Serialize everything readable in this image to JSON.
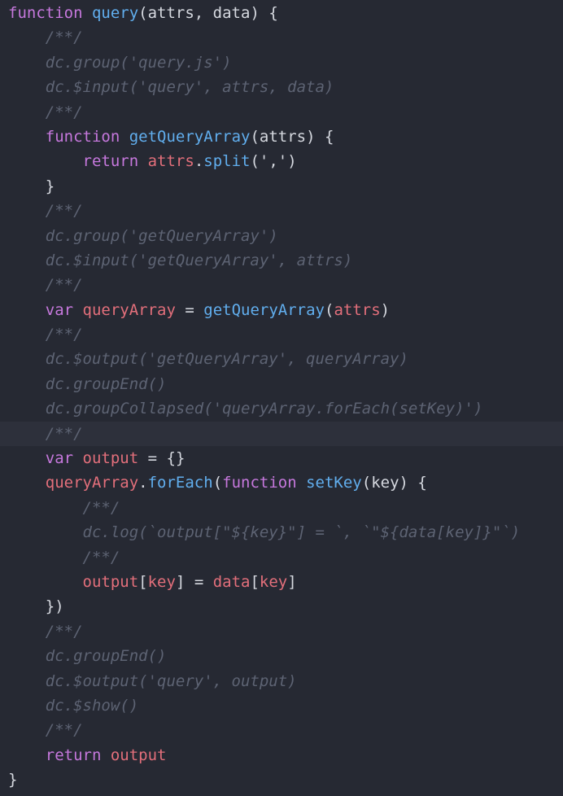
{
  "editor": {
    "colors": {
      "background": "#262933",
      "highlight_line": "#2d303b",
      "keyword": "#c678dd",
      "function": "#61aeee",
      "text": "#d6d9e0",
      "variable": "#e36f7b",
      "comment": "#5d6373"
    },
    "highlighted_line_index": 17,
    "lines": [
      [
        {
          "t": "kw",
          "v": "function"
        },
        {
          "t": "txt",
          "v": " "
        },
        {
          "t": "fn",
          "v": "query"
        },
        {
          "t": "txt",
          "v": "(attrs, data) {"
        }
      ],
      [
        {
          "t": "txt",
          "v": "    "
        },
        {
          "t": "cm",
          "v": "/**/"
        }
      ],
      [
        {
          "t": "txt",
          "v": "    "
        },
        {
          "t": "cm",
          "v": "dc.group('query.js')"
        }
      ],
      [
        {
          "t": "txt",
          "v": "    "
        },
        {
          "t": "cm",
          "v": "dc.$input('query', attrs, data)"
        }
      ],
      [
        {
          "t": "txt",
          "v": "    "
        },
        {
          "t": "cm",
          "v": "/**/"
        }
      ],
      [
        {
          "t": "txt",
          "v": "    "
        },
        {
          "t": "kw",
          "v": "function"
        },
        {
          "t": "txt",
          "v": " "
        },
        {
          "t": "fn",
          "v": "getQueryArray"
        },
        {
          "t": "txt",
          "v": "(attrs) {"
        }
      ],
      [
        {
          "t": "txt",
          "v": "        "
        },
        {
          "t": "kw",
          "v": "return"
        },
        {
          "t": "txt",
          "v": " "
        },
        {
          "t": "var",
          "v": "attrs"
        },
        {
          "t": "txt",
          "v": "."
        },
        {
          "t": "fn",
          "v": "split"
        },
        {
          "t": "txt",
          "v": "(',')"
        }
      ],
      [
        {
          "t": "txt",
          "v": "    }"
        }
      ],
      [
        {
          "t": "txt",
          "v": "    "
        },
        {
          "t": "cm",
          "v": "/**/"
        }
      ],
      [
        {
          "t": "txt",
          "v": "    "
        },
        {
          "t": "cm",
          "v": "dc.group('getQueryArray')"
        }
      ],
      [
        {
          "t": "txt",
          "v": "    "
        },
        {
          "t": "cm",
          "v": "dc.$input('getQueryArray', attrs)"
        }
      ],
      [
        {
          "t": "txt",
          "v": "    "
        },
        {
          "t": "cm",
          "v": "/**/"
        }
      ],
      [
        {
          "t": "txt",
          "v": "    "
        },
        {
          "t": "kw",
          "v": "var"
        },
        {
          "t": "txt",
          "v": " "
        },
        {
          "t": "var",
          "v": "queryArray"
        },
        {
          "t": "txt",
          "v": " = "
        },
        {
          "t": "fn",
          "v": "getQueryArray"
        },
        {
          "t": "txt",
          "v": "("
        },
        {
          "t": "var",
          "v": "attrs"
        },
        {
          "t": "txt",
          "v": ")"
        }
      ],
      [
        {
          "t": "txt",
          "v": "    "
        },
        {
          "t": "cm",
          "v": "/**/"
        }
      ],
      [
        {
          "t": "txt",
          "v": "    "
        },
        {
          "t": "cm",
          "v": "dc.$output('getQueryArray', queryArray)"
        }
      ],
      [
        {
          "t": "txt",
          "v": "    "
        },
        {
          "t": "cm",
          "v": "dc.groupEnd()"
        }
      ],
      [
        {
          "t": "txt",
          "v": "    "
        },
        {
          "t": "cm",
          "v": "dc.groupCollapsed('queryArray.forEach(setKey)')"
        }
      ],
      [
        {
          "t": "txt",
          "v": "    "
        },
        {
          "t": "cm",
          "v": "/**/"
        }
      ],
      [
        {
          "t": "txt",
          "v": "    "
        },
        {
          "t": "kw",
          "v": "var"
        },
        {
          "t": "txt",
          "v": " "
        },
        {
          "t": "var",
          "v": "output"
        },
        {
          "t": "txt",
          "v": " = {}"
        }
      ],
      [
        {
          "t": "txt",
          "v": "    "
        },
        {
          "t": "var",
          "v": "queryArray"
        },
        {
          "t": "txt",
          "v": "."
        },
        {
          "t": "fn",
          "v": "forEach"
        },
        {
          "t": "txt",
          "v": "("
        },
        {
          "t": "kw",
          "v": "function"
        },
        {
          "t": "txt",
          "v": " "
        },
        {
          "t": "fn",
          "v": "setKey"
        },
        {
          "t": "txt",
          "v": "(key) {"
        }
      ],
      [
        {
          "t": "txt",
          "v": "        "
        },
        {
          "t": "cm",
          "v": "/**/"
        }
      ],
      [
        {
          "t": "txt",
          "v": "        "
        },
        {
          "t": "cm",
          "v": "dc.log(`output[\"${key}\"] = `, `\"${data[key]}\"`)"
        }
      ],
      [
        {
          "t": "txt",
          "v": "        "
        },
        {
          "t": "cm",
          "v": "/**/"
        }
      ],
      [
        {
          "t": "txt",
          "v": "        "
        },
        {
          "t": "var",
          "v": "output"
        },
        {
          "t": "txt",
          "v": "["
        },
        {
          "t": "var",
          "v": "key"
        },
        {
          "t": "txt",
          "v": "] = "
        },
        {
          "t": "var",
          "v": "data"
        },
        {
          "t": "txt",
          "v": "["
        },
        {
          "t": "var",
          "v": "key"
        },
        {
          "t": "txt",
          "v": "]"
        }
      ],
      [
        {
          "t": "txt",
          "v": "    })"
        }
      ],
      [
        {
          "t": "txt",
          "v": "    "
        },
        {
          "t": "cm",
          "v": "/**/"
        }
      ],
      [
        {
          "t": "txt",
          "v": "    "
        },
        {
          "t": "cm",
          "v": "dc.groupEnd()"
        }
      ],
      [
        {
          "t": "txt",
          "v": "    "
        },
        {
          "t": "cm",
          "v": "dc.$output('query', output)"
        }
      ],
      [
        {
          "t": "txt",
          "v": "    "
        },
        {
          "t": "cm",
          "v": "dc.$show()"
        }
      ],
      [
        {
          "t": "txt",
          "v": "    "
        },
        {
          "t": "cm",
          "v": "/**/"
        }
      ],
      [
        {
          "t": "txt",
          "v": "    "
        },
        {
          "t": "kw",
          "v": "return"
        },
        {
          "t": "txt",
          "v": " "
        },
        {
          "t": "var",
          "v": "output"
        }
      ],
      [
        {
          "t": "txt",
          "v": "}"
        }
      ]
    ]
  }
}
